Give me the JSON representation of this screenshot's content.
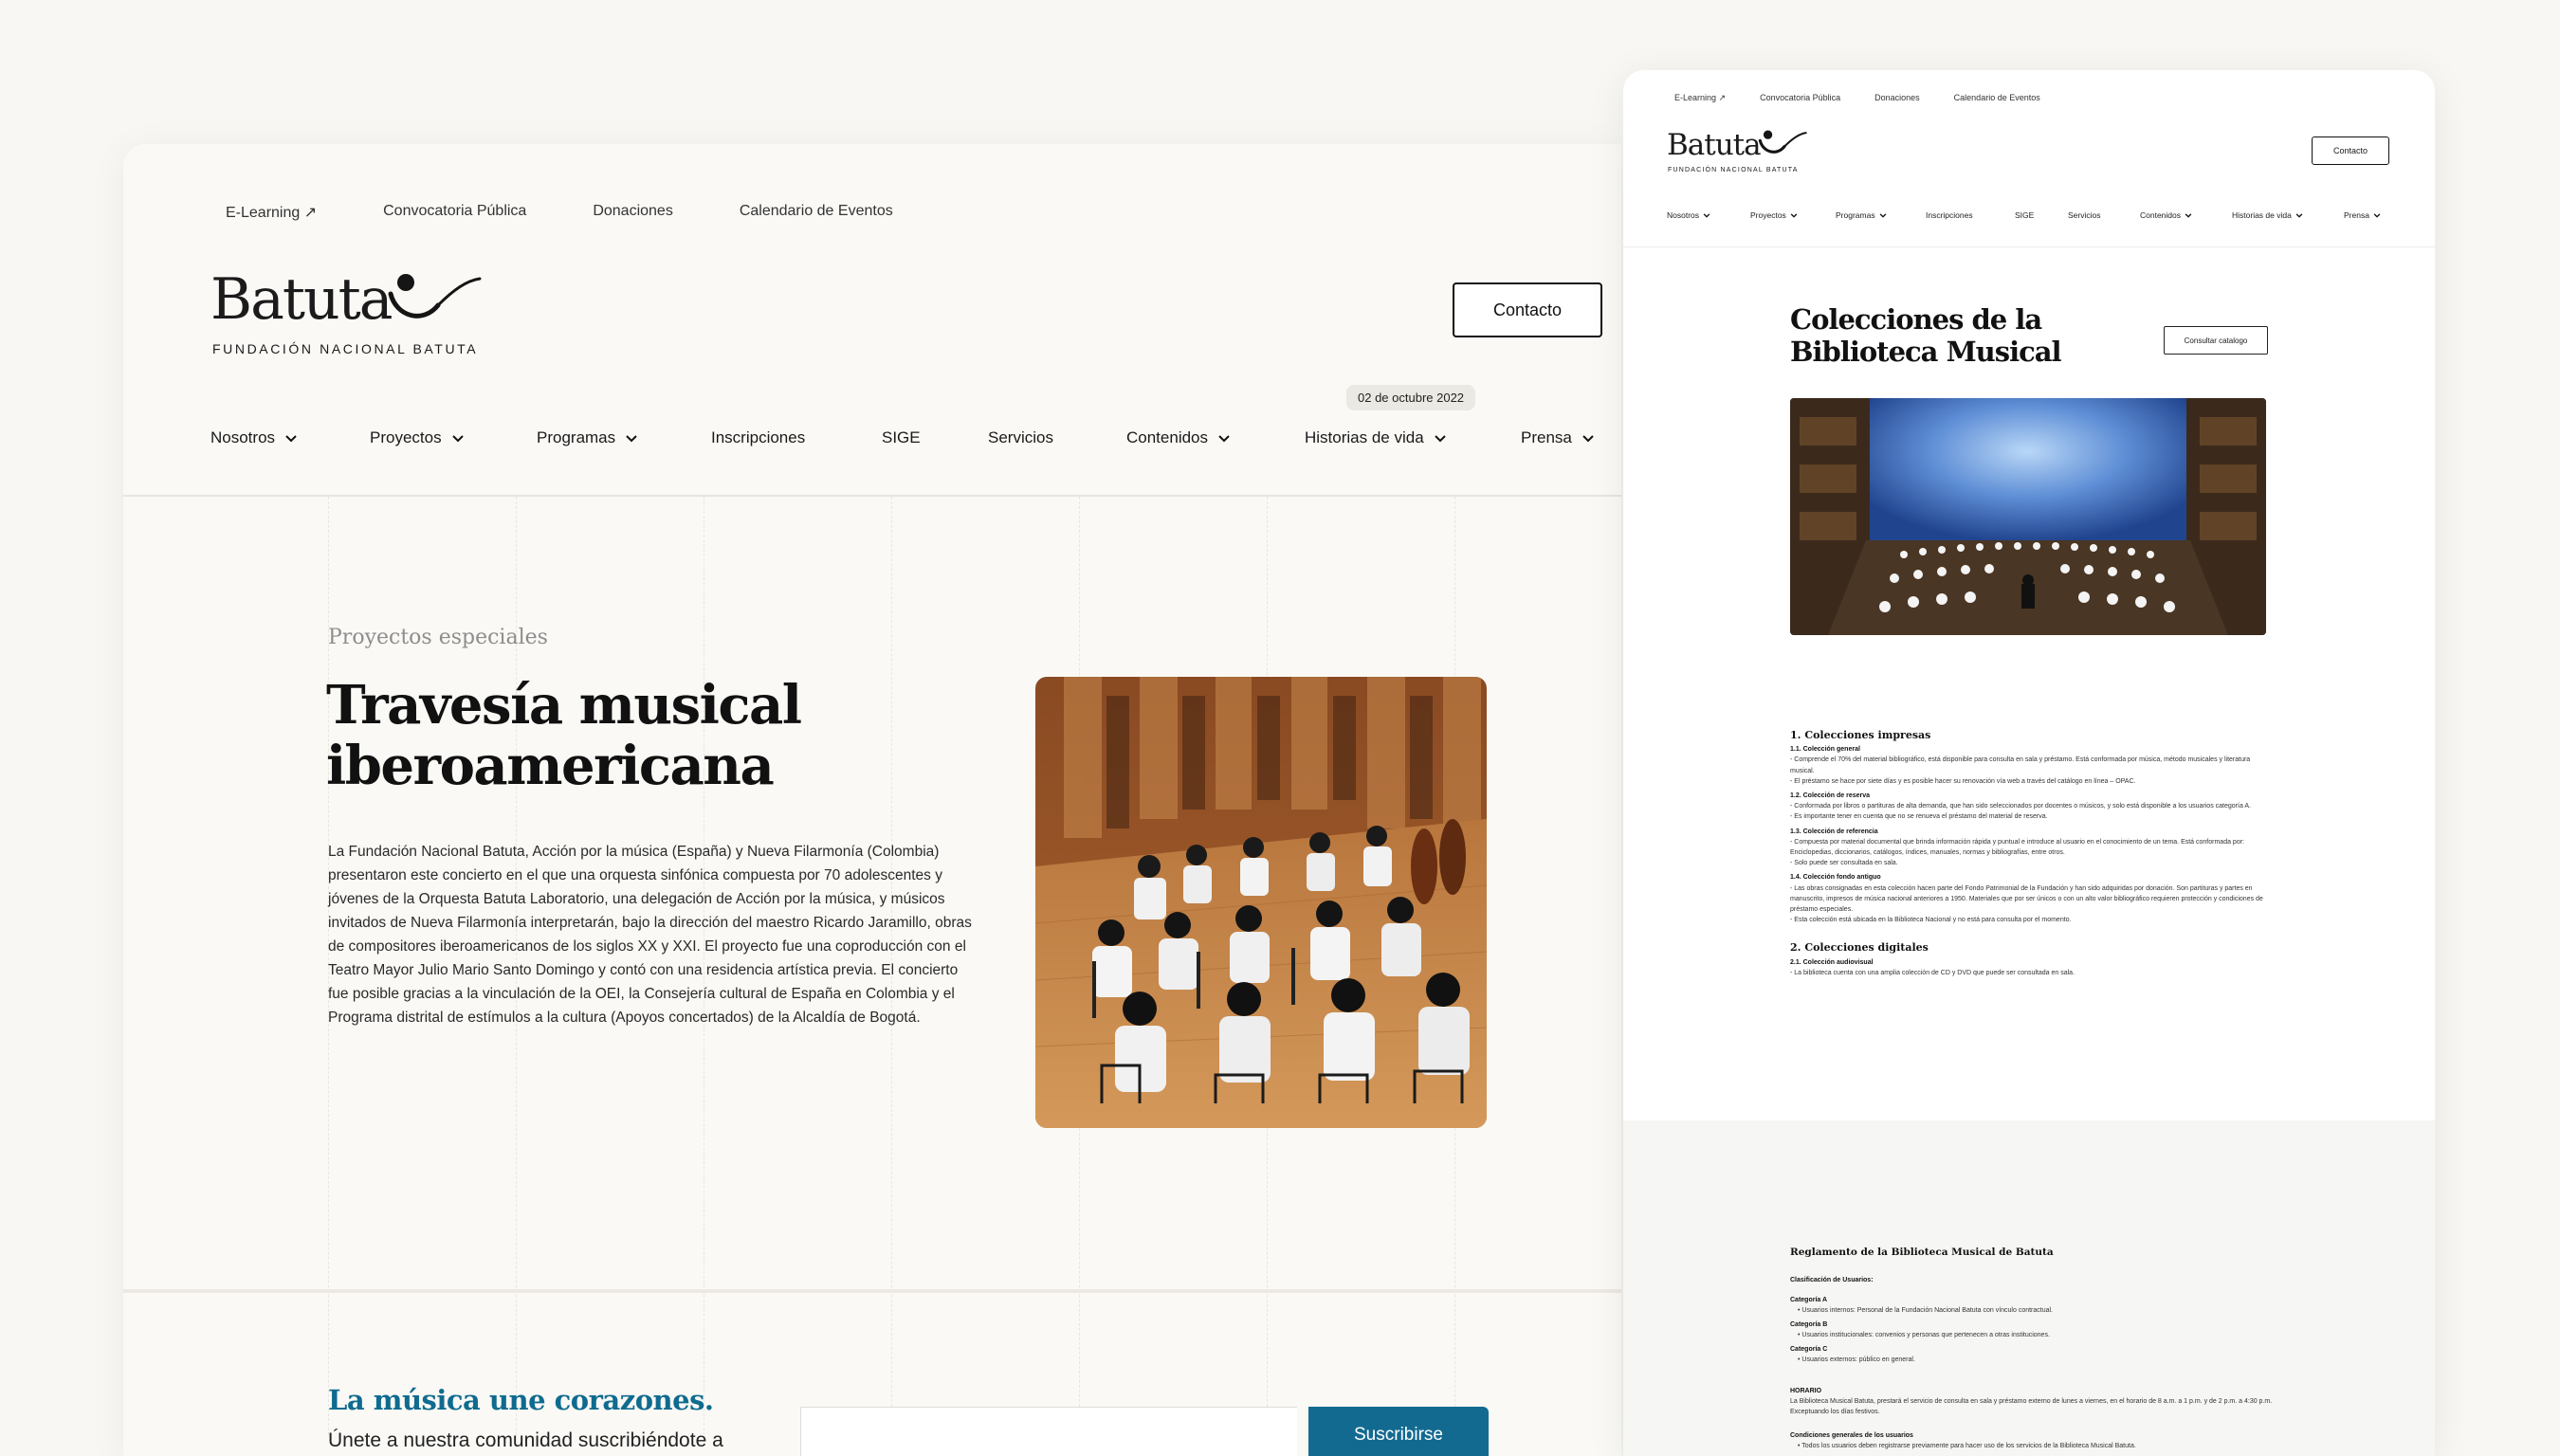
{
  "left_page": {
    "top_links": [
      "E-Learning ↗",
      "Convocatoria Pública",
      "Donaciones",
      "Calendario de Eventos"
    ],
    "logo": {
      "word": "Batuta",
      "registered": "®",
      "subtitle": "FUNDACIÓN NACIONAL BATUTA"
    },
    "contact_label": "Contacto",
    "date_badge": "02 de octubre 2022",
    "nav": [
      {
        "label": "Nosotros",
        "dropdown": true
      },
      {
        "label": "Proyectos",
        "dropdown": true
      },
      {
        "label": "Programas",
        "dropdown": true
      },
      {
        "label": "Inscripciones",
        "dropdown": false
      },
      {
        "label": "SIGE",
        "dropdown": false
      },
      {
        "label": "Servicios",
        "dropdown": false
      },
      {
        "label": "Contenidos",
        "dropdown": true
      },
      {
        "label": "Historias de vida",
        "dropdown": true
      },
      {
        "label": "Prensa",
        "dropdown": true
      }
    ],
    "eyebrow": "Proyectos especiales",
    "title": "Travesía musical iberoamericana",
    "body": "La Fundación Nacional Batuta, Acción por la música (España) y Nueva Filarmonía (Colombia) presentaron este concierto en el que una orquesta sinfónica compuesta por 70 adolescentes y jóvenes de la Orquesta Batuta Laboratorio, una delegación de Acción por la música, y músicos invitados de Nueva Filarmonía interpretarán, bajo la dirección del maestro Ricardo Jaramillo, obras de compositores iberoamericanos de los siglos XX y XXI. El proyecto fue una coproducción con el Teatro Mayor Julio Mario Santo Domingo y contó con una residencia artística previa. El concierto fue posible gracias a la vinculación de la OEI, la Consejería cultural de España en Colombia y el Programa distrital de estímulos a la cultura (Apoyos concertados) de la Alcaldía de Bogotá.",
    "newsletter": {
      "heading": "La música une corazones.",
      "text": "Únete a nuestra comunidad suscribiéndote a",
      "button": "Suscribirse"
    }
  },
  "right_page": {
    "top_links": [
      "E-Learning ↗",
      "Convocatoria Pública",
      "Donaciones",
      "Calendario de Eventos"
    ],
    "contact_label": "Contacto",
    "nav": [
      {
        "label": "Nosotros",
        "dropdown": true
      },
      {
        "label": "Proyectos",
        "dropdown": true
      },
      {
        "label": "Programas",
        "dropdown": true
      },
      {
        "label": "Inscripciones",
        "dropdown": false
      },
      {
        "label": "SIGE",
        "dropdown": false
      },
      {
        "label": "Servicios",
        "dropdown": false
      },
      {
        "label": "Contenidos",
        "dropdown": true
      },
      {
        "label": "Historias de vida",
        "dropdown": true
      },
      {
        "label": "Prensa",
        "dropdown": true
      }
    ],
    "title": "Colecciones de la Biblioteca Musical",
    "catalog_button": "Consultar catalogo",
    "sections": [
      {
        "heading": "1. Colecciones impresas",
        "items": [
          {
            "sub": "1.1. Colección general",
            "lines": [
              "- Comprende el 70% del material bibliográfico, está disponible para consulta en sala y préstamo. Está conformada por música, método musicales y literatura musical.",
              "- El préstamo se hace por siete días y es posible hacer su renovación vía web a través del catálogo en línea – OPAC."
            ]
          },
          {
            "sub": "1.2. Colección de reserva",
            "lines": [
              "- Conformada por libros o partituras de alta demanda, que han sido seleccionados por docentes o músicos, y solo está disponible a los usuarios categoría A.",
              "- Es importante tener en cuenta que no se renueva el préstamo del material de reserva."
            ]
          },
          {
            "sub": "1.3. Colección de referencia",
            "lines": [
              "- Compuesta por material documental que brinda información rápida y puntual e introduce al usuario en el conocimiento de un tema. Está conformada por: Enciclopedias, diccionarios, catálogos, índices, manuales, normas y bibliografías, entre otros.",
              "- Solo puede ser consultada en sala."
            ]
          },
          {
            "sub": "1.4. Colección fondo antiguo",
            "lines": [
              "- Las obras consignadas en esta colección hacen parte del Fondo Patrimonial de la Fundación y han sido adquiridas por donación. Son partituras y partes en manuscrito, impresos de música nacional anteriores a 1950. Materiales que por ser únicos o con un alto valor bibliográfico requieren protección y condiciones de préstamo especiales.",
              "- Esta colección está ubicada en la Biblioteca Nacional y no está para consulta por el momento."
            ]
          }
        ]
      },
      {
        "heading": "2. Colecciones digitales",
        "items": [
          {
            "sub": "2.1. Colección audiovisual",
            "lines": [
              "- La biblioteca cuenta con una amplia colección de CD y DVD que puede ser consultada en sala."
            ]
          }
        ]
      }
    ],
    "regulation": {
      "title": "Reglamento de la Biblioteca Musical de Batuta",
      "classification": "Clasificación de Usuarios:",
      "categories": [
        {
          "name": "Categoría A",
          "desc": "Usuarios internos: Personal de la Fundación Nacional Batuta con vínculo contractual."
        },
        {
          "name": "Categoría B",
          "desc": "Usuarios institucionales: convenios y personas que pertenecen a otras instituciones."
        },
        {
          "name": "Categoría C",
          "desc": "Usuarios externos: público en general."
        }
      ],
      "schedule_title": "HORARIO",
      "schedule_text": "La Biblioteca Musical Batuta, prestará el servicio de consulta en sala y préstamo externo de lunes a viernes, en el horario de 8 a.m. a 1 p.m. y de 2 p.m. a 4:30 p.m. Exceptuando los días festivos.",
      "conditions_title": "Condiciones generales de los usuarios",
      "conditions_text": "Todos los usuarios deben registrarse previamente para hacer uso de los servicios de la Biblioteca Musical Batuta."
    }
  },
  "colors": {
    "accent": "#136a90",
    "page_bg": "#f8f7f3",
    "ink": "#111111"
  }
}
